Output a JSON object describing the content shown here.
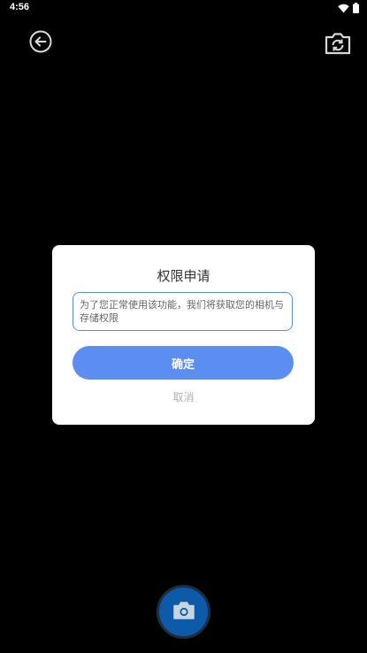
{
  "status_bar": {
    "time": "4:56",
    "icons": [
      "wifi-icon",
      "battery-icon"
    ]
  },
  "top_bar": {
    "back_icon": "back-arrow-icon",
    "switch_icon": "switch-camera-icon"
  },
  "dialog": {
    "title": "权限申请",
    "message": "为了您正常使用该功能，我们将获取您的相机与存储权限",
    "confirm_label": "确定",
    "cancel_label": "取消"
  },
  "shutter": {
    "icon": "camera-icon"
  },
  "colors": {
    "accent": "#5b8ef0",
    "border": "#5a8ee0",
    "shutter": "#0d5aa8",
    "background": "#000000"
  }
}
